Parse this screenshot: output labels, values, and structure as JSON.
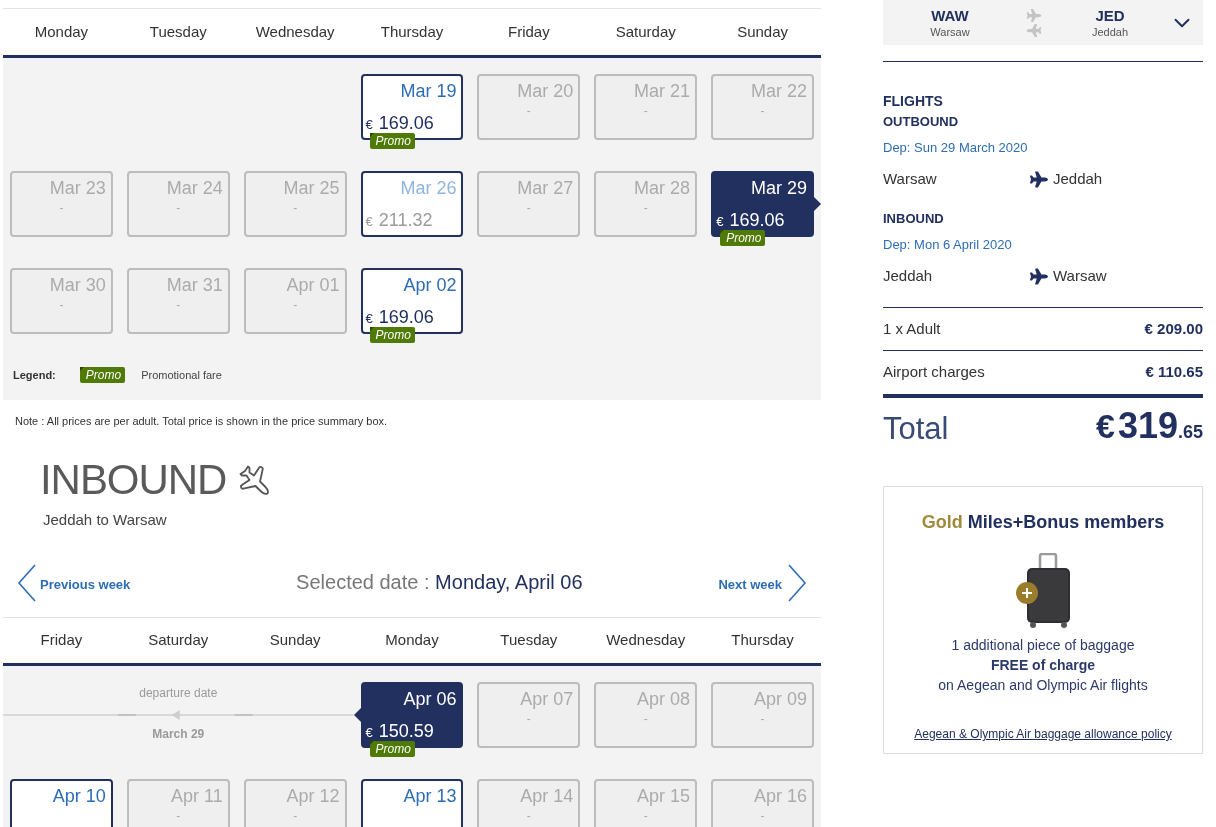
{
  "outbound": {
    "weekdays": [
      "Monday",
      "Tuesday",
      "Wednesday",
      "Thursday",
      "Friday",
      "Saturday",
      "Sunday"
    ],
    "weeks": [
      [
        {
          "kind": "blank"
        },
        {
          "kind": "blank"
        },
        {
          "kind": "blank"
        },
        {
          "kind": "fare",
          "date": "Mar 19",
          "currency": "€",
          "price": "169.06",
          "badge": "Promo",
          "selected": false,
          "faded": false
        },
        {
          "kind": "unavailable",
          "date": "Mar 20",
          "price": "-",
          "selected": false
        },
        {
          "kind": "unavailable",
          "date": "Mar 21",
          "price": "-",
          "selected": false
        },
        {
          "kind": "unavailable",
          "date": "Mar 22",
          "price": "-",
          "selected": false
        }
      ],
      [
        {
          "kind": "unavailable",
          "date": "Mar 23",
          "price": "-",
          "selected": false
        },
        {
          "kind": "unavailable",
          "date": "Mar 24",
          "price": "-",
          "selected": false
        },
        {
          "kind": "unavailable",
          "date": "Mar 25",
          "price": "-",
          "selected": false
        },
        {
          "kind": "fare",
          "date": "Mar 26",
          "currency": "€",
          "price": "211.32",
          "selected": false,
          "faded": true
        },
        {
          "kind": "unavailable",
          "date": "Mar 27",
          "price": "-",
          "selected": false
        },
        {
          "kind": "unavailable",
          "date": "Mar 28",
          "price": "-",
          "selected": false
        },
        {
          "kind": "fare",
          "date": "Mar 29",
          "currency": "€",
          "price": "169.06",
          "badge": "Promo",
          "selected": true,
          "faded": false,
          "pointer_left": false
        }
      ],
      [
        {
          "kind": "unavailable",
          "date": "Mar 30",
          "price": "-",
          "selected": false
        },
        {
          "kind": "unavailable",
          "date": "Mar 31",
          "price": "-",
          "selected": false
        },
        {
          "kind": "unavailable",
          "date": "Apr 01",
          "price": "-",
          "selected": false
        },
        {
          "kind": "fare",
          "date": "Apr 02",
          "currency": "€",
          "price": "169.06",
          "badge": "Promo",
          "selected": false,
          "faded": false
        },
        {
          "kind": "blank"
        },
        {
          "kind": "blank"
        },
        {
          "kind": "blank"
        }
      ]
    ],
    "legend": {
      "label": "Legend:",
      "badge": "Promo",
      "text": "Promotional fare"
    },
    "note": "Note : All prices are per adult. Total price is shown in the price summary box."
  },
  "inbound": {
    "heading": "INBOUND",
    "route": "Jeddah to Warsaw",
    "previous_week": "Previous week",
    "selected_label": "Selected date :",
    "selected_value": "Monday, April 06",
    "next_week": "Next week",
    "weekdays": [
      "Friday",
      "Saturday",
      "Sunday",
      "Monday",
      "Tuesday",
      "Wednesday",
      "Thursday"
    ],
    "weeks": [
      [
        {
          "kind": "departure_marker",
          "label": "departure date",
          "date": "March 29"
        },
        {
          "kind": "fare",
          "date": "Apr 06",
          "currency": "€",
          "price": "150.59",
          "badge": "Promo",
          "selected": true,
          "faded": false,
          "pointer_left": true
        },
        {
          "kind": "unavailable",
          "date": "Apr 07",
          "price": "-",
          "selected": false
        },
        {
          "kind": "unavailable",
          "date": "Apr 08",
          "price": "-",
          "selected": false
        },
        {
          "kind": "unavailable",
          "date": "Apr 09",
          "price": "-",
          "selected": false
        }
      ],
      [
        {
          "kind": "fare",
          "date": "Apr 10",
          "selected": false,
          "faded": false
        },
        {
          "kind": "unavailable",
          "date": "Apr 11",
          "price": "-",
          "selected": false
        },
        {
          "kind": "unavailable",
          "date": "Apr 12",
          "price": "-",
          "selected": false
        },
        {
          "kind": "fare",
          "date": "Apr 13",
          "selected": false,
          "faded": false
        },
        {
          "kind": "unavailable",
          "date": "Apr 14",
          "price": "-",
          "selected": false
        },
        {
          "kind": "unavailable",
          "date": "Apr 15",
          "price": "-",
          "selected": false
        },
        {
          "kind": "unavailable",
          "date": "Apr 16",
          "price": "-",
          "selected": false
        }
      ]
    ]
  },
  "summary": {
    "route": {
      "from_code": "WAW",
      "from_city": "Warsaw",
      "to_code": "JED",
      "to_city": "Jeddah",
      "expanded": false
    },
    "heading": "FLIGHTS",
    "legs": [
      {
        "title": "OUTBOUND",
        "departure": "Dep: Sun 29 March 2020",
        "from": "Warsaw",
        "to": "Jeddah"
      },
      {
        "title": "INBOUND",
        "departure": "Dep: Mon 6 April 2020",
        "from": "Jeddah",
        "to": "Warsaw"
      }
    ],
    "price_lines": [
      {
        "label": "1 x Adult",
        "amount": "€ 209.00"
      },
      {
        "label": "Airport charges",
        "amount": "€ 110.65"
      }
    ],
    "total": {
      "label": "Total",
      "currency": "€",
      "amount": "319",
      "cents": ".65"
    }
  },
  "promo_card": {
    "title_highlight": "Gold",
    "title": "Miles+Bonus members",
    "benefit": "1 additional piece of baggage\n**FREE of charge**\non Aegean and Olympic Air flights",
    "link": "Aegean & Olympic Air baggage allowance policy"
  }
}
